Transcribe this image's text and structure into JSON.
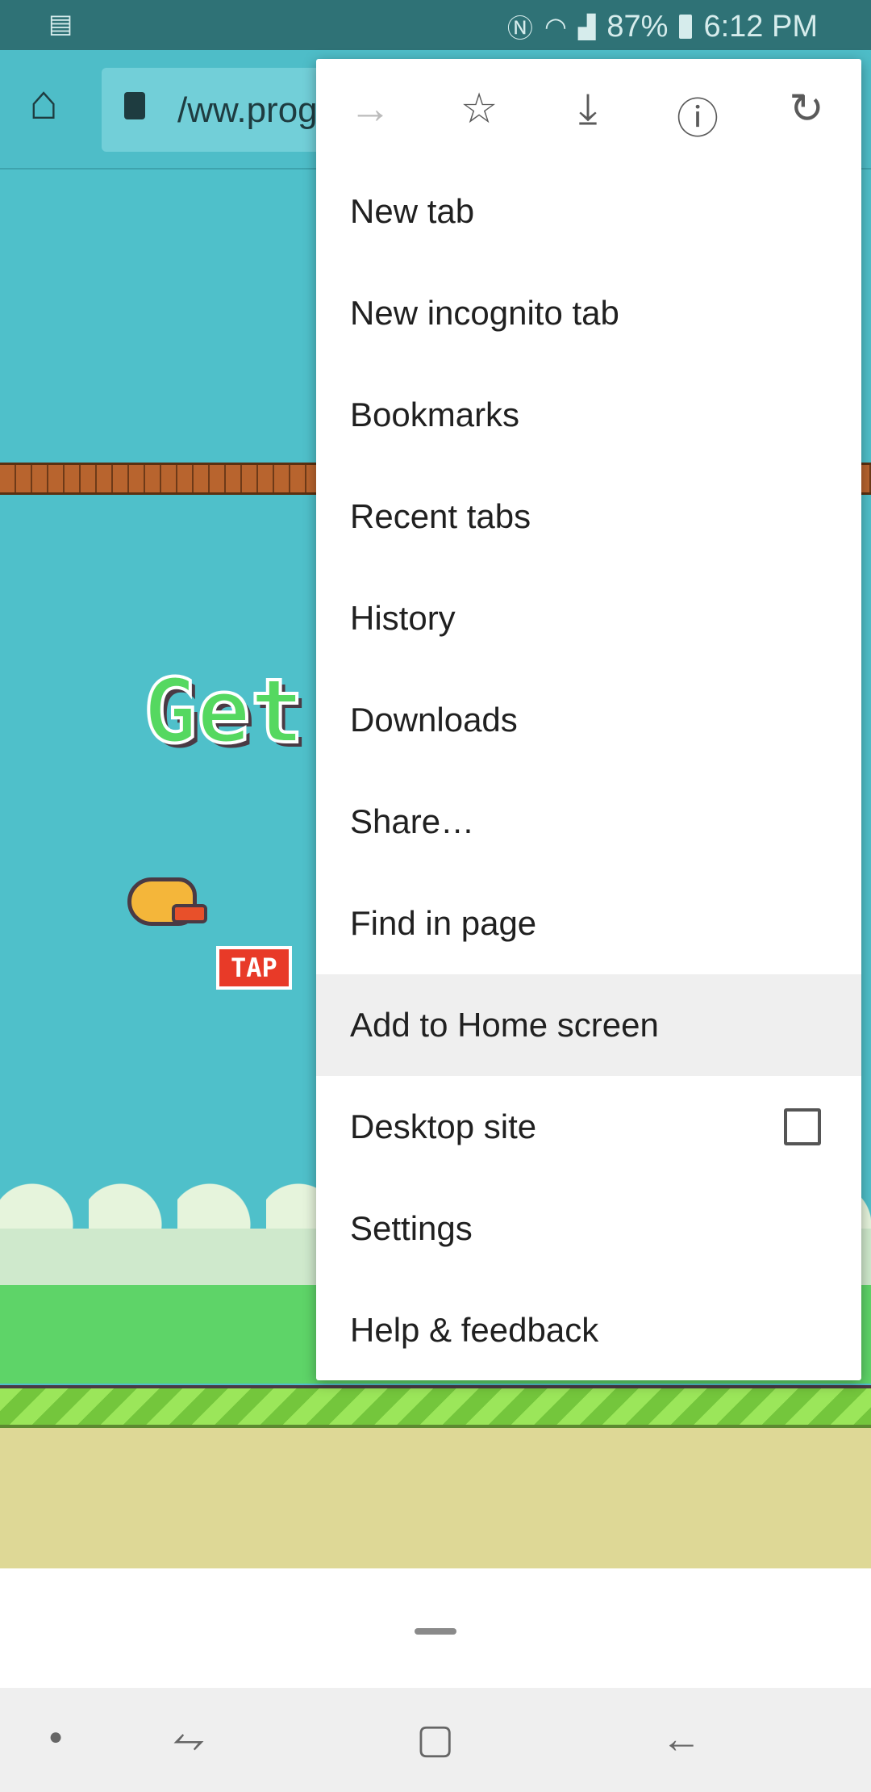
{
  "status_bar": {
    "battery": "87%",
    "time": "6:12 PM",
    "icons": [
      "sim-card-icon",
      "nfc-icon",
      "wifi-icon",
      "signal-icon",
      "battery-icon"
    ]
  },
  "toolbar": {
    "url": "/ww.prog"
  },
  "game": {
    "title": "Get R",
    "tap_label": "TAP"
  },
  "menu": {
    "icons": [
      "forward-icon",
      "bookmark-star-icon",
      "download-icon",
      "info-icon",
      "refresh-icon"
    ],
    "items": [
      {
        "label": "New tab"
      },
      {
        "label": "New incognito tab"
      },
      {
        "label": "Bookmarks"
      },
      {
        "label": "Recent tabs"
      },
      {
        "label": "History"
      },
      {
        "label": "Downloads"
      },
      {
        "label": "Share…"
      },
      {
        "label": "Find in page"
      },
      {
        "label": "Add to Home screen",
        "highlighted": true
      },
      {
        "label": "Desktop site",
        "checkbox": false
      },
      {
        "label": "Settings"
      },
      {
        "label": "Help & feedback"
      }
    ]
  },
  "colors": {
    "status_bar": "#2f7276",
    "toolbar": "#4ebdc8",
    "sky": "#4fc0ca",
    "highlight": "#efefef"
  }
}
